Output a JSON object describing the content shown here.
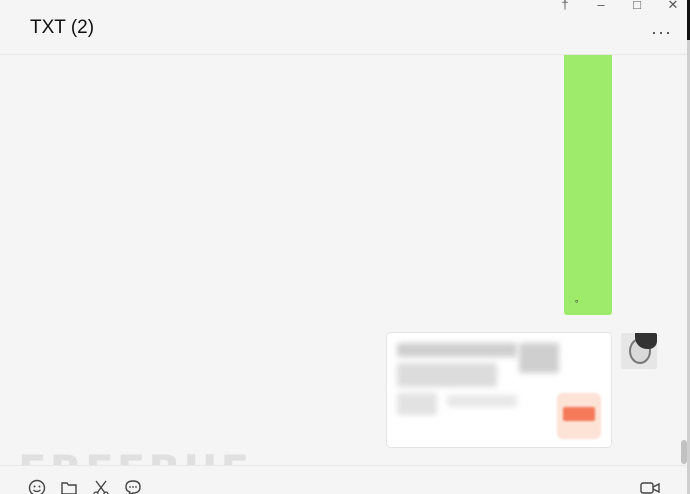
{
  "window": {
    "title": "TXT (2)",
    "controls": [
      "pin-icon",
      "minimize-icon",
      "maximize-icon",
      "close-icon"
    ],
    "more_label": "···"
  },
  "messages": {
    "green_bubble": {
      "text": "。",
      "color": "#9eea6a"
    },
    "card": {
      "blurred": true
    }
  },
  "toolbar": {
    "icons": [
      "emoji-icon",
      "folder-icon",
      "scissors-icon",
      "chat-history-icon"
    ],
    "video_call_icon": "video-call-icon"
  },
  "watermark": {
    "text": "FREEBUF"
  }
}
